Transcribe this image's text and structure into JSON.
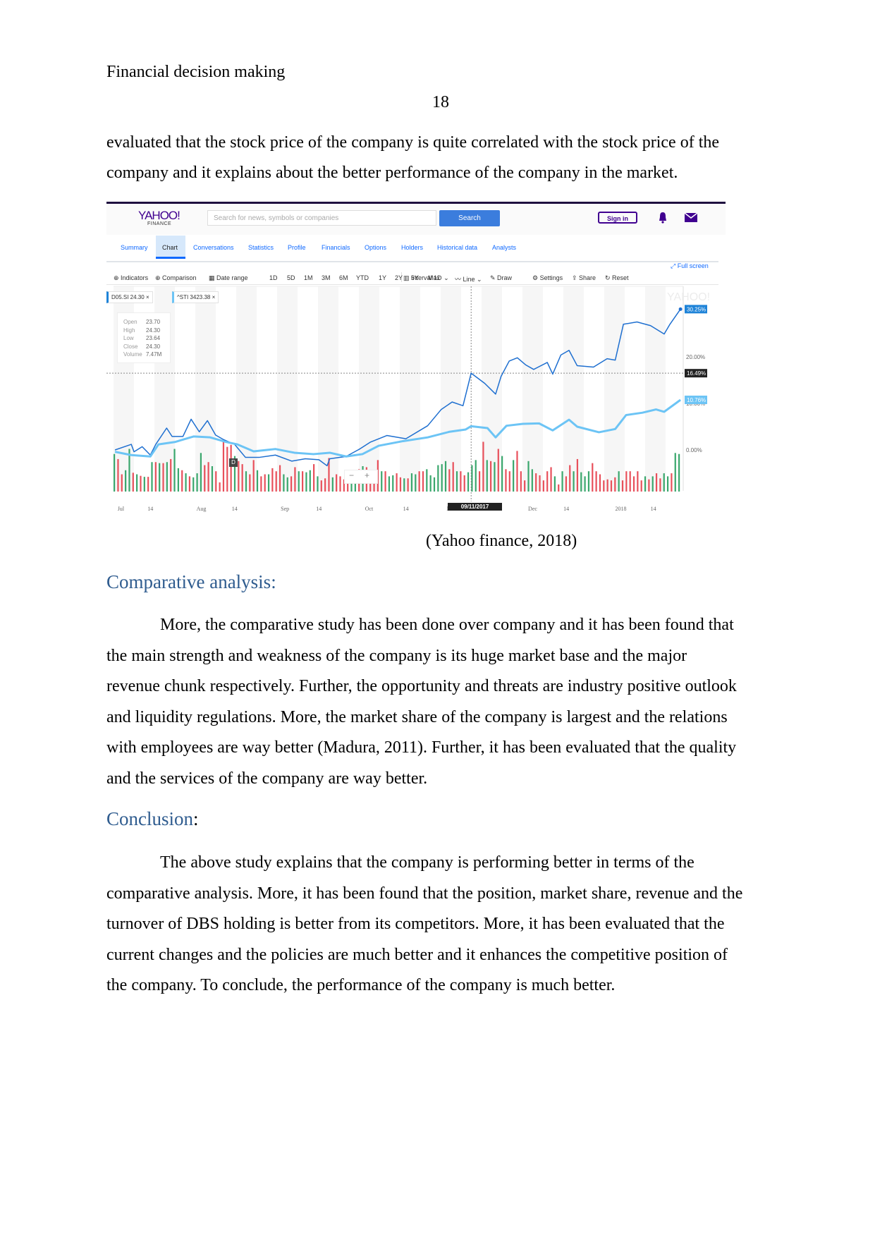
{
  "header": {
    "running_title": "Financial decision making",
    "page_number": "18"
  },
  "intro_lines": [
    "evaluated that the stock price of the company is quite correlated with the stock price of the",
    "company and it explains about the better performance of the company in the market."
  ],
  "figure": {
    "caption": "(Yahoo finance, 2018)",
    "app": {
      "logo": "YAHOO!",
      "logo_sub": "FINANCE",
      "search_placeholder": "Search for news, symbols or companies",
      "search_button": "Search",
      "sign_in": "Sign in",
      "brand_color": "#400090",
      "accent_color": "#0f69ff",
      "icons": {
        "bell": "bell-icon",
        "mail": "mail-icon"
      },
      "tabs": [
        {
          "label": "Summary"
        },
        {
          "label": "Chart",
          "active": true
        },
        {
          "label": "Conversations"
        },
        {
          "label": "Statistics"
        },
        {
          "label": "Profile"
        },
        {
          "label": "Financials"
        },
        {
          "label": "Options"
        },
        {
          "label": "Holders"
        },
        {
          "label": "Historical data"
        },
        {
          "label": "Analysts"
        }
      ],
      "full_screen": "Full screen",
      "toolbar": {
        "indicators": "Indicators",
        "comparison": "Comparison",
        "date_range": "Date range",
        "ranges": [
          "1D",
          "5D",
          "1M",
          "3M",
          "6M",
          "YTD",
          "1Y",
          "2Y",
          "5Y",
          "Max"
        ],
        "interval": "Interval",
        "interval_value": "1D",
        "chart_type": "Line",
        "draw": "Draw",
        "settings": "Settings",
        "share": "Share",
        "reset": "Reset"
      },
      "legend_chips": [
        {
          "label": "D05.SI 24.30",
          "close": "×"
        },
        {
          "label": "^STI 3423.38",
          "close": "×"
        }
      ],
      "ohlc": [
        {
          "label": "Open",
          "value": "23.70"
        },
        {
          "label": "High",
          "value": "24.30"
        },
        {
          "label": "Low",
          "value": "23.64"
        },
        {
          "label": "Close",
          "value": "24.30"
        },
        {
          "label": "Volume",
          "value": "7.47M"
        }
      ],
      "crosshair_date": "09/11/2017",
      "dividend_marker": "D",
      "zoom_minus": "−",
      "zoom_plus": "+"
    }
  },
  "chart_data": {
    "type": "line",
    "x_range": [
      "2017-07-01",
      "2018-01-26"
    ],
    "y_unit": "%",
    "y_ticks": [
      "0.00%",
      "10.00%",
      "20.00%"
    ],
    "y_tick_values": [
      0,
      10,
      20
    ],
    "x_ticks": [
      {
        "label": "Jul",
        "date": "2017-07-03"
      },
      {
        "label": "14",
        "date": "2017-07-14"
      },
      {
        "label": "Aug",
        "date": "2017-08-01"
      },
      {
        "label": "14",
        "date": "2017-08-14"
      },
      {
        "label": "Sep",
        "date": "2017-09-01"
      },
      {
        "label": "14",
        "date": "2017-09-14"
      },
      {
        "label": "Oct",
        "date": "2017-10-02"
      },
      {
        "label": "14",
        "date": "2017-10-16"
      },
      {
        "label": "N",
        "date": "2017-11-01"
      },
      {
        "label": "Dec",
        "date": "2017-12-01"
      },
      {
        "label": "14",
        "date": "2017-12-14"
      },
      {
        "label": "2018",
        "date": "2018-01-02"
      },
      {
        "label": "14",
        "date": "2018-01-15"
      }
    ],
    "crosshair": {
      "date": "2017-11-09",
      "value": 16.49,
      "label": "16.49%"
    },
    "series": [
      {
        "name": "D05.SI",
        "color": "#1e6fd0",
        "last_label": "30.25%",
        "points": [
          [
            "2017-07-01",
            0
          ],
          [
            "2017-07-07",
            1.2
          ],
          [
            "2017-07-08",
            -0.4
          ],
          [
            "2017-07-11",
            0.7
          ],
          [
            "2017-07-14",
            -1.1
          ],
          [
            "2017-07-16",
            1.2
          ],
          [
            "2017-07-20",
            4.7
          ],
          [
            "2017-07-22",
            2.9
          ],
          [
            "2017-07-26",
            2.9
          ],
          [
            "2017-07-29",
            6.6
          ],
          [
            "2017-08-01",
            3.9
          ],
          [
            "2017-08-04",
            6.3
          ],
          [
            "2017-08-07",
            3.2
          ],
          [
            "2017-08-10",
            2.2
          ],
          [
            "2017-08-12",
            1.7
          ],
          [
            "2017-08-14",
            1.2
          ],
          [
            "2017-08-18",
            -1.6
          ],
          [
            "2017-08-23",
            -1.6
          ],
          [
            "2017-08-29",
            -1.1
          ],
          [
            "2017-09-04",
            -2.4
          ],
          [
            "2017-09-09",
            -1.9
          ],
          [
            "2017-09-14",
            -2.1
          ],
          [
            "2017-09-17",
            -3.4
          ],
          [
            "2017-09-18",
            -1.9
          ],
          [
            "2017-09-24",
            -1.4
          ],
          [
            "2017-09-29",
            0.2
          ],
          [
            "2017-10-03",
            1.7
          ],
          [
            "2017-10-09",
            3.1
          ],
          [
            "2017-10-16",
            2.4
          ],
          [
            "2017-10-24",
            5.2
          ],
          [
            "2017-10-29",
            8.7
          ],
          [
            "2017-11-02",
            10.3
          ],
          [
            "2017-11-06",
            9.5
          ],
          [
            "2017-11-09",
            16.5
          ],
          [
            "2017-11-14",
            14.3
          ],
          [
            "2017-11-18",
            12.0
          ],
          [
            "2017-11-20",
            15.8
          ],
          [
            "2017-11-23",
            19.1
          ],
          [
            "2017-11-26",
            19.8
          ],
          [
            "2017-11-29",
            18.3
          ],
          [
            "2017-12-02",
            17.3
          ],
          [
            "2017-12-07",
            18.8
          ],
          [
            "2017-12-09",
            16.3
          ],
          [
            "2017-12-12",
            20.4
          ],
          [
            "2017-12-15",
            21.4
          ],
          [
            "2017-12-18",
            18.1
          ],
          [
            "2017-12-24",
            17.8
          ],
          [
            "2017-12-29",
            19.6
          ],
          [
            "2018-01-01",
            19.3
          ],
          [
            "2018-01-04",
            27.0
          ],
          [
            "2018-01-09",
            27.5
          ],
          [
            "2018-01-14",
            26.7
          ],
          [
            "2018-01-19",
            24.9
          ],
          [
            "2018-01-21",
            26.9
          ],
          [
            "2018-01-25",
            30.25
          ]
        ]
      },
      {
        "name": "^STI",
        "color": "#6cc4f5",
        "last_label": "10.76%",
        "points": [
          [
            "2017-07-01",
            -0.4
          ],
          [
            "2017-07-07",
            -1.1
          ],
          [
            "2017-07-14",
            -1.4
          ],
          [
            "2017-07-17",
            1.2
          ],
          [
            "2017-07-23",
            1.7
          ],
          [
            "2017-07-30",
            2.9
          ],
          [
            "2017-08-05",
            2.7
          ],
          [
            "2017-08-11",
            1.7
          ],
          [
            "2017-08-15",
            1.2
          ],
          [
            "2017-08-21",
            -0.3
          ],
          [
            "2017-08-29",
            0.2
          ],
          [
            "2017-09-05",
            -0.6
          ],
          [
            "2017-09-12",
            -0.9
          ],
          [
            "2017-09-18",
            -0.6
          ],
          [
            "2017-09-24",
            -1.4
          ],
          [
            "2017-09-30",
            -0.9
          ],
          [
            "2017-10-06",
            0.9
          ],
          [
            "2017-10-15",
            1.9
          ],
          [
            "2017-10-24",
            2.7
          ],
          [
            "2017-11-01",
            3.9
          ],
          [
            "2017-11-07",
            4.4
          ],
          [
            "2017-11-09",
            5.1
          ],
          [
            "2017-11-15",
            4.7
          ],
          [
            "2017-11-18",
            2.7
          ],
          [
            "2017-11-22",
            5.2
          ],
          [
            "2017-11-28",
            5.6
          ],
          [
            "2017-12-04",
            5.7
          ],
          [
            "2017-12-09",
            4.2
          ],
          [
            "2017-12-15",
            6.5
          ],
          [
            "2017-12-18",
            5.0
          ],
          [
            "2017-12-26",
            3.8
          ],
          [
            "2018-01-01",
            4.5
          ],
          [
            "2018-01-05",
            7.5
          ],
          [
            "2018-01-11",
            8.0
          ],
          [
            "2018-01-16",
            8.7
          ],
          [
            "2018-01-19",
            8.2
          ],
          [
            "2018-01-25",
            10.76
          ]
        ]
      }
    ],
    "volume_colors": {
      "up": "#3aa76d",
      "down": "#e8505b"
    },
    "volume_relative": [
      74,
      -64,
      -34,
      42,
      84,
      -37,
      34,
      -31,
      29,
      -29,
      58,
      -58,
      56,
      -56,
      58,
      -64,
      84,
      46,
      -42,
      36,
      -30,
      28,
      36,
      76,
      -52,
      -58,
      50,
      -40,
      -18,
      -98,
      -88,
      -92,
      70,
      -60,
      -54,
      40,
      -34,
      -62,
      42,
      -30,
      -34,
      34,
      -46,
      -40,
      -52,
      34,
      28,
      -30,
      -48,
      40,
      -40,
      38,
      42,
      -54,
      30,
      -22,
      -26,
      -66,
      28,
      -34,
      -30,
      -24,
      -22,
      38,
      34,
      -44,
      50,
      -48,
      -36,
      -36,
      -62,
      40,
      -40,
      30,
      32,
      -36,
      -28,
      26,
      -26,
      36,
      34,
      -40,
      -40,
      44,
      32,
      28,
      52,
      54,
      60,
      -44,
      -58,
      40,
      -40,
      -32,
      38,
      52,
      62,
      -40,
      -98,
      62,
      -60,
      58,
      -84,
      70,
      -44,
      -40,
      62,
      -80,
      -40,
      -22,
      60,
      44,
      -36,
      -32,
      -22,
      -40,
      -48,
      30,
      -14,
      40,
      -30,
      -52,
      40,
      -64,
      38,
      30,
      40,
      -56,
      -40,
      -34,
      -22,
      -24,
      -22,
      -28,
      40,
      -22,
      -40,
      -40,
      -30,
      -40,
      -22,
      30,
      -24,
      30,
      -36,
      -26,
      36,
      30,
      -36,
      76,
      74
    ]
  },
  "sections": [
    {
      "heading": "Comparative analysis:",
      "lines": [
        "More, the comparative study has been done over company and it has been found that",
        "the main strength and weakness of the company is its huge market base and the major",
        "revenue chunk respectively. Further, the opportunity and threats are industry positive outlook",
        "and liquidity regulations. More, the market share of the company is largest and the relations",
        "with employees are way better (Madura, 2011). Further, it has been evaluated that the quality",
        "and the services of the company are way better."
      ]
    },
    {
      "heading": "Conclusion",
      "heading_suffix": ":",
      "lines": [
        "The above study explains that the company is performing better in terms of the",
        "comparative analysis. More, it has been found that the position, market share, revenue and the",
        "turnover of DBS holding is better from its competitors. More, it has been evaluated that the",
        "current changes and the policies are much better and it enhances the competitive position of",
        "the company. To conclude, the performance of the company is much better."
      ]
    }
  ]
}
